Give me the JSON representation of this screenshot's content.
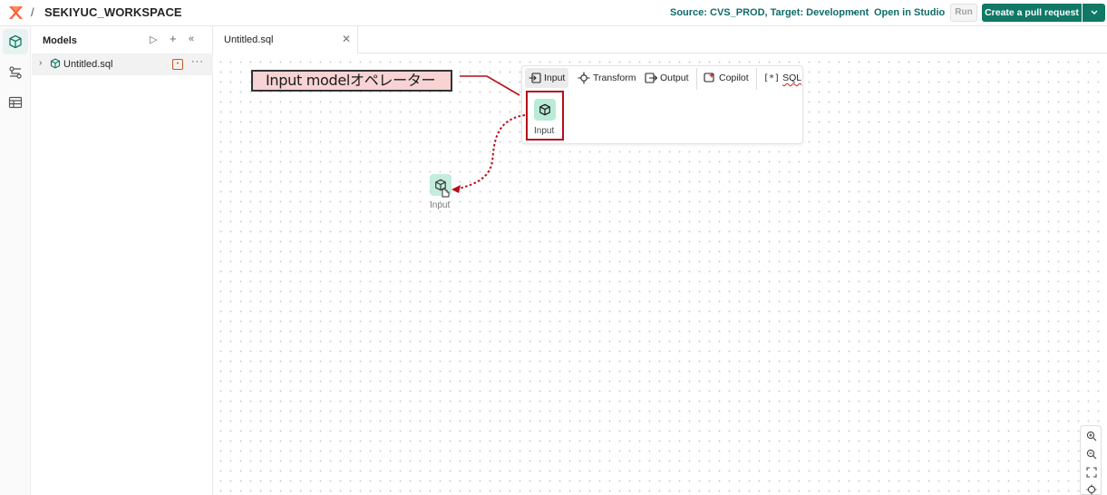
{
  "header": {
    "workspace": "SEKIYUC_WORKSPACE",
    "separator": "/",
    "source_target": "Source: CVS_PROD, Target: Development",
    "open_studio": "Open in Studio",
    "run": "Run",
    "pull_request": "Create a pull request"
  },
  "sidebar": {
    "icons": [
      "cube-icon",
      "transform-settings-icon",
      "table-icon"
    ]
  },
  "models_panel": {
    "title": "Models",
    "items": [
      {
        "label": "Untitled.sql"
      }
    ]
  },
  "tabs": [
    {
      "label": "Untitled.sql"
    }
  ],
  "toolbar": {
    "input": "Input",
    "transform": "Transform",
    "output": "Output",
    "copilot": "Copilot",
    "sql": "SQL"
  },
  "palette": {
    "input_label": "Input"
  },
  "canvas": {
    "dragged_node_label": "Input"
  },
  "annotation": {
    "callout_text": "Input modelオペレーター"
  },
  "colors": {
    "brand": "#117865",
    "accent_text": "#0f6c68",
    "node_fill": "#b9ebd6",
    "highlight": "#b40e18",
    "callout_fill": "#f8d3d3"
  }
}
